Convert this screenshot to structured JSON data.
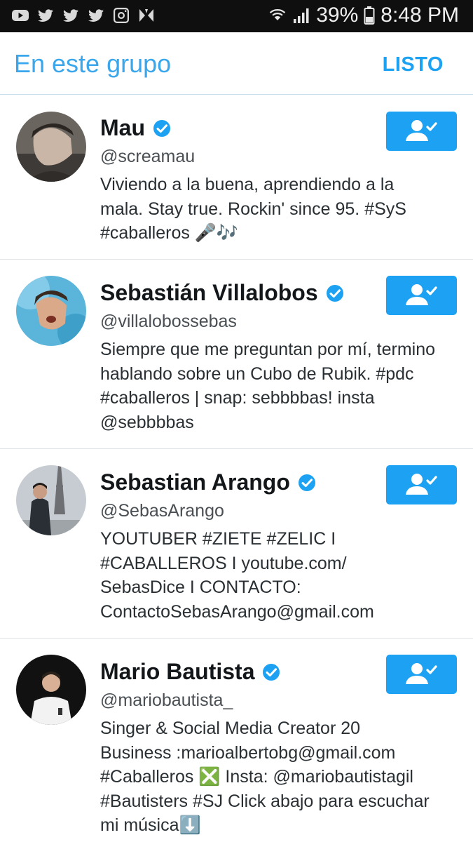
{
  "status_bar": {
    "icons_left": [
      "youtube-icon",
      "twitter-icon",
      "twitter-icon",
      "twitter-icon",
      "instagram-icon",
      "app-icon"
    ],
    "battery": "39%",
    "time": "8:48 PM"
  },
  "header": {
    "title": "En este grupo",
    "done_label": "LISTO"
  },
  "users": [
    {
      "name": "Mau",
      "handle": "@screamau",
      "bio_lines": [
        "Viviendo a la buena, aprendiendo a la",
        "mala. Stay true. Rockin' since 95. #SyS",
        "#caballeros 🎤🎶"
      ]
    },
    {
      "name": "Sebastián Villalobos",
      "handle": "@villalobossebas",
      "bio_lines": [
        "Siempre que me preguntan por mí, termino",
        "hablando sobre un Cubo de Rubik. #pdc",
        "#caballeros | snap: sebbbbas! insta",
        "@sebbbbas"
      ]
    },
    {
      "name": "Sebastian Arango",
      "handle": "@SebasArango",
      "bio_lines": [
        "YOUTUBER #ZIETE #ZELIC I",
        "#CABALLEROS I youtube.com/",
        "SebasDice I CONTACTO:",
        "ContactoSebasArango@gmail.com"
      ]
    },
    {
      "name": "Mario Bautista",
      "handle": "@mariobautista_",
      "bio_lines": [
        "Singer & Social Media Creator 20",
        "Business :marioalbertobg@gmail.com",
        "#Caballeros ❎ Insta: @mariobautistagil",
        "#Bautisters #SJ Click abajo para escuchar",
        "mi música⬇️"
      ]
    }
  ],
  "colors": {
    "accent": "#1da1f2",
    "header_title": "#3aa7ec",
    "status_bar_bg": "#0f0f0f",
    "divider": "#dfe3e6"
  }
}
